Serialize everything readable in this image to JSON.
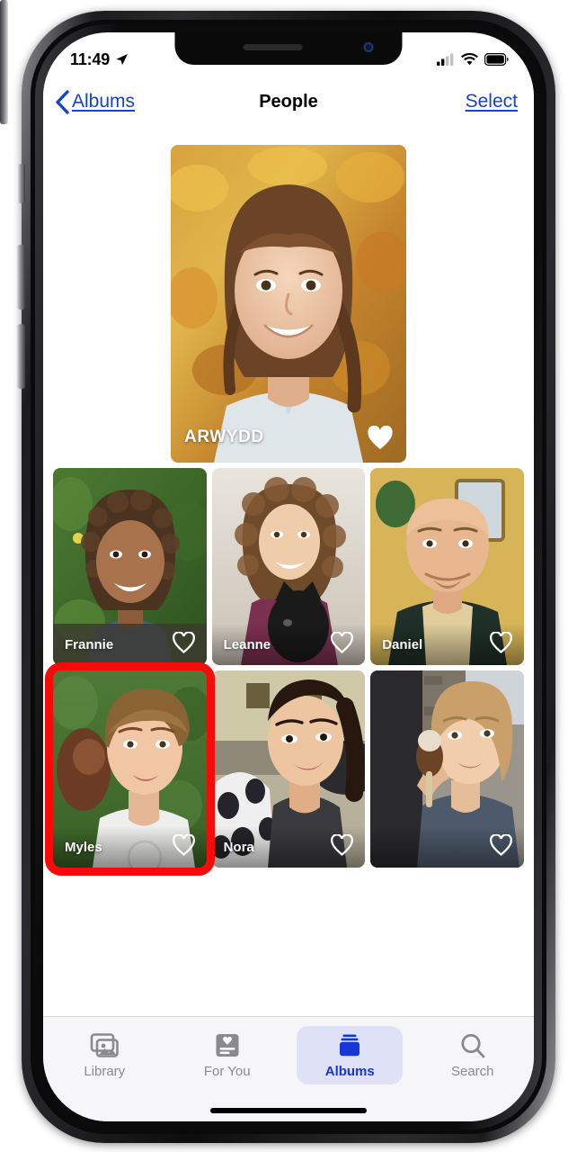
{
  "status_bar": {
    "time": "11:49",
    "location_icon": "location-arrow-icon",
    "cellular_icon": "cellular-signal-icon",
    "cellular_bars_filled": 2,
    "cellular_bars_total": 4,
    "wifi_icon": "wifi-icon",
    "battery_icon": "battery-full-icon"
  },
  "nav_bar": {
    "back_label": "Albums",
    "back_icon": "chevron-left-icon",
    "title": "People",
    "select_label": "Select"
  },
  "featured": {
    "name": "ARWYDD",
    "favorite": true,
    "heart_icon": "heart-filled-icon"
  },
  "people_rows": [
    [
      {
        "name": "Frannie",
        "favorite": false,
        "heart_icon": "heart-outline-icon",
        "scrim": "solid"
      },
      {
        "name": "Leanne",
        "favorite": false,
        "heart_icon": "heart-outline-icon",
        "scrim": "gradient"
      },
      {
        "name": "Daniel",
        "favorite": false,
        "heart_icon": "heart-outline-icon",
        "scrim": "gradient"
      }
    ],
    [
      {
        "name": "Myles",
        "favorite": false,
        "heart_icon": "heart-outline-icon",
        "scrim": "gradient",
        "highlighted": true
      },
      {
        "name": "Nora",
        "favorite": false,
        "heart_icon": "heart-outline-icon",
        "scrim": "gradient"
      },
      {
        "name": "",
        "favorite": false,
        "heart_icon": "heart-outline-icon",
        "scrim": "gradient"
      }
    ]
  ],
  "tab_bar": {
    "items": [
      {
        "label": "Library",
        "icon": "photo-stack-icon",
        "active": false
      },
      {
        "label": "For You",
        "icon": "heart-card-icon",
        "active": false
      },
      {
        "label": "Albums",
        "icon": "albums-folder-icon",
        "active": true
      },
      {
        "label": "Search",
        "icon": "magnifier-icon",
        "active": false
      }
    ]
  },
  "annotation": {
    "highlight_color": "#f60b0b",
    "target": "Myles"
  },
  "colors": {
    "link_blue": "#1644c4",
    "active_tab_blue": "#1636d8",
    "active_tab_pill": "#dfe2f7",
    "inactive_gray": "#8a8a8e"
  }
}
